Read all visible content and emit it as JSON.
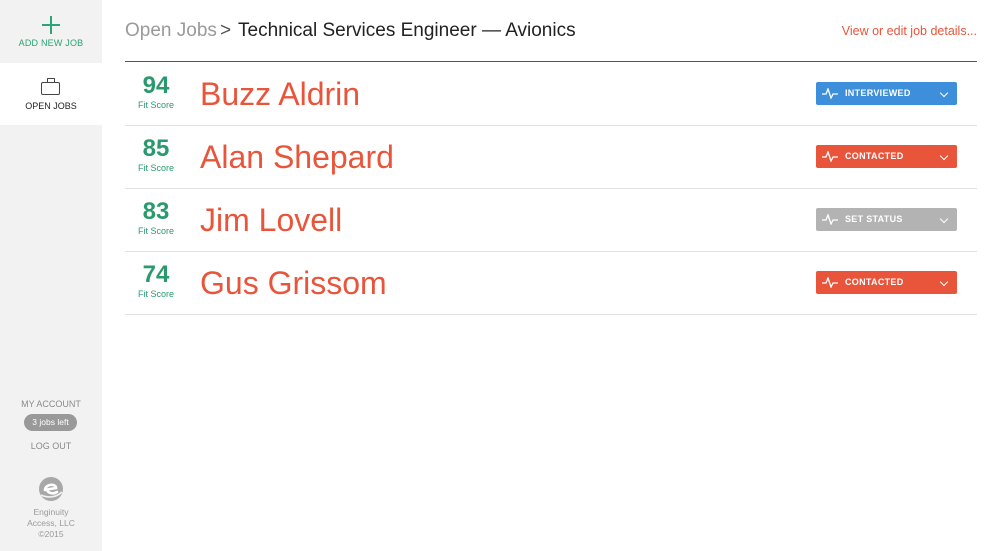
{
  "sidebar": {
    "add_new_job": "ADD NEW JOB",
    "open_jobs": "OPEN JOBS",
    "my_account": "MY ACCOUNT",
    "jobs_left": "3 jobs left",
    "log_out": "LOG OUT",
    "brand": {
      "line1": "Enginuity",
      "line2": "Access, LLC",
      "line3": "©2015"
    }
  },
  "header": {
    "breadcrumb_root": "Open Jobs",
    "separator": ">",
    "job_title": "Technical Services Engineer — Avionics",
    "edit_link": "View or edit job details..."
  },
  "score_label": "Fit Score",
  "candidates": [
    {
      "score": "94",
      "name": "Buzz Aldrin",
      "status": "INTERVIEWED",
      "status_color": "#3d8fdc"
    },
    {
      "score": "85",
      "name": "Alan Shepard",
      "status": "CONTACTED",
      "status_color": "#e8553b"
    },
    {
      "score": "83",
      "name": "Jim Lovell",
      "status": "SET STATUS",
      "status_color": "#b3b3b3"
    },
    {
      "score": "74",
      "name": "Gus Grissom",
      "status": "CONTACTED",
      "status_color": "#e8553b"
    }
  ],
  "colors": {
    "accent": "#e8553b",
    "score": "#2a9a6e",
    "add": "#2aa573"
  },
  "icons": [
    "plus-icon",
    "briefcase-icon",
    "pulse-icon",
    "chevron-down-icon",
    "enginuity-logo-icon"
  ]
}
